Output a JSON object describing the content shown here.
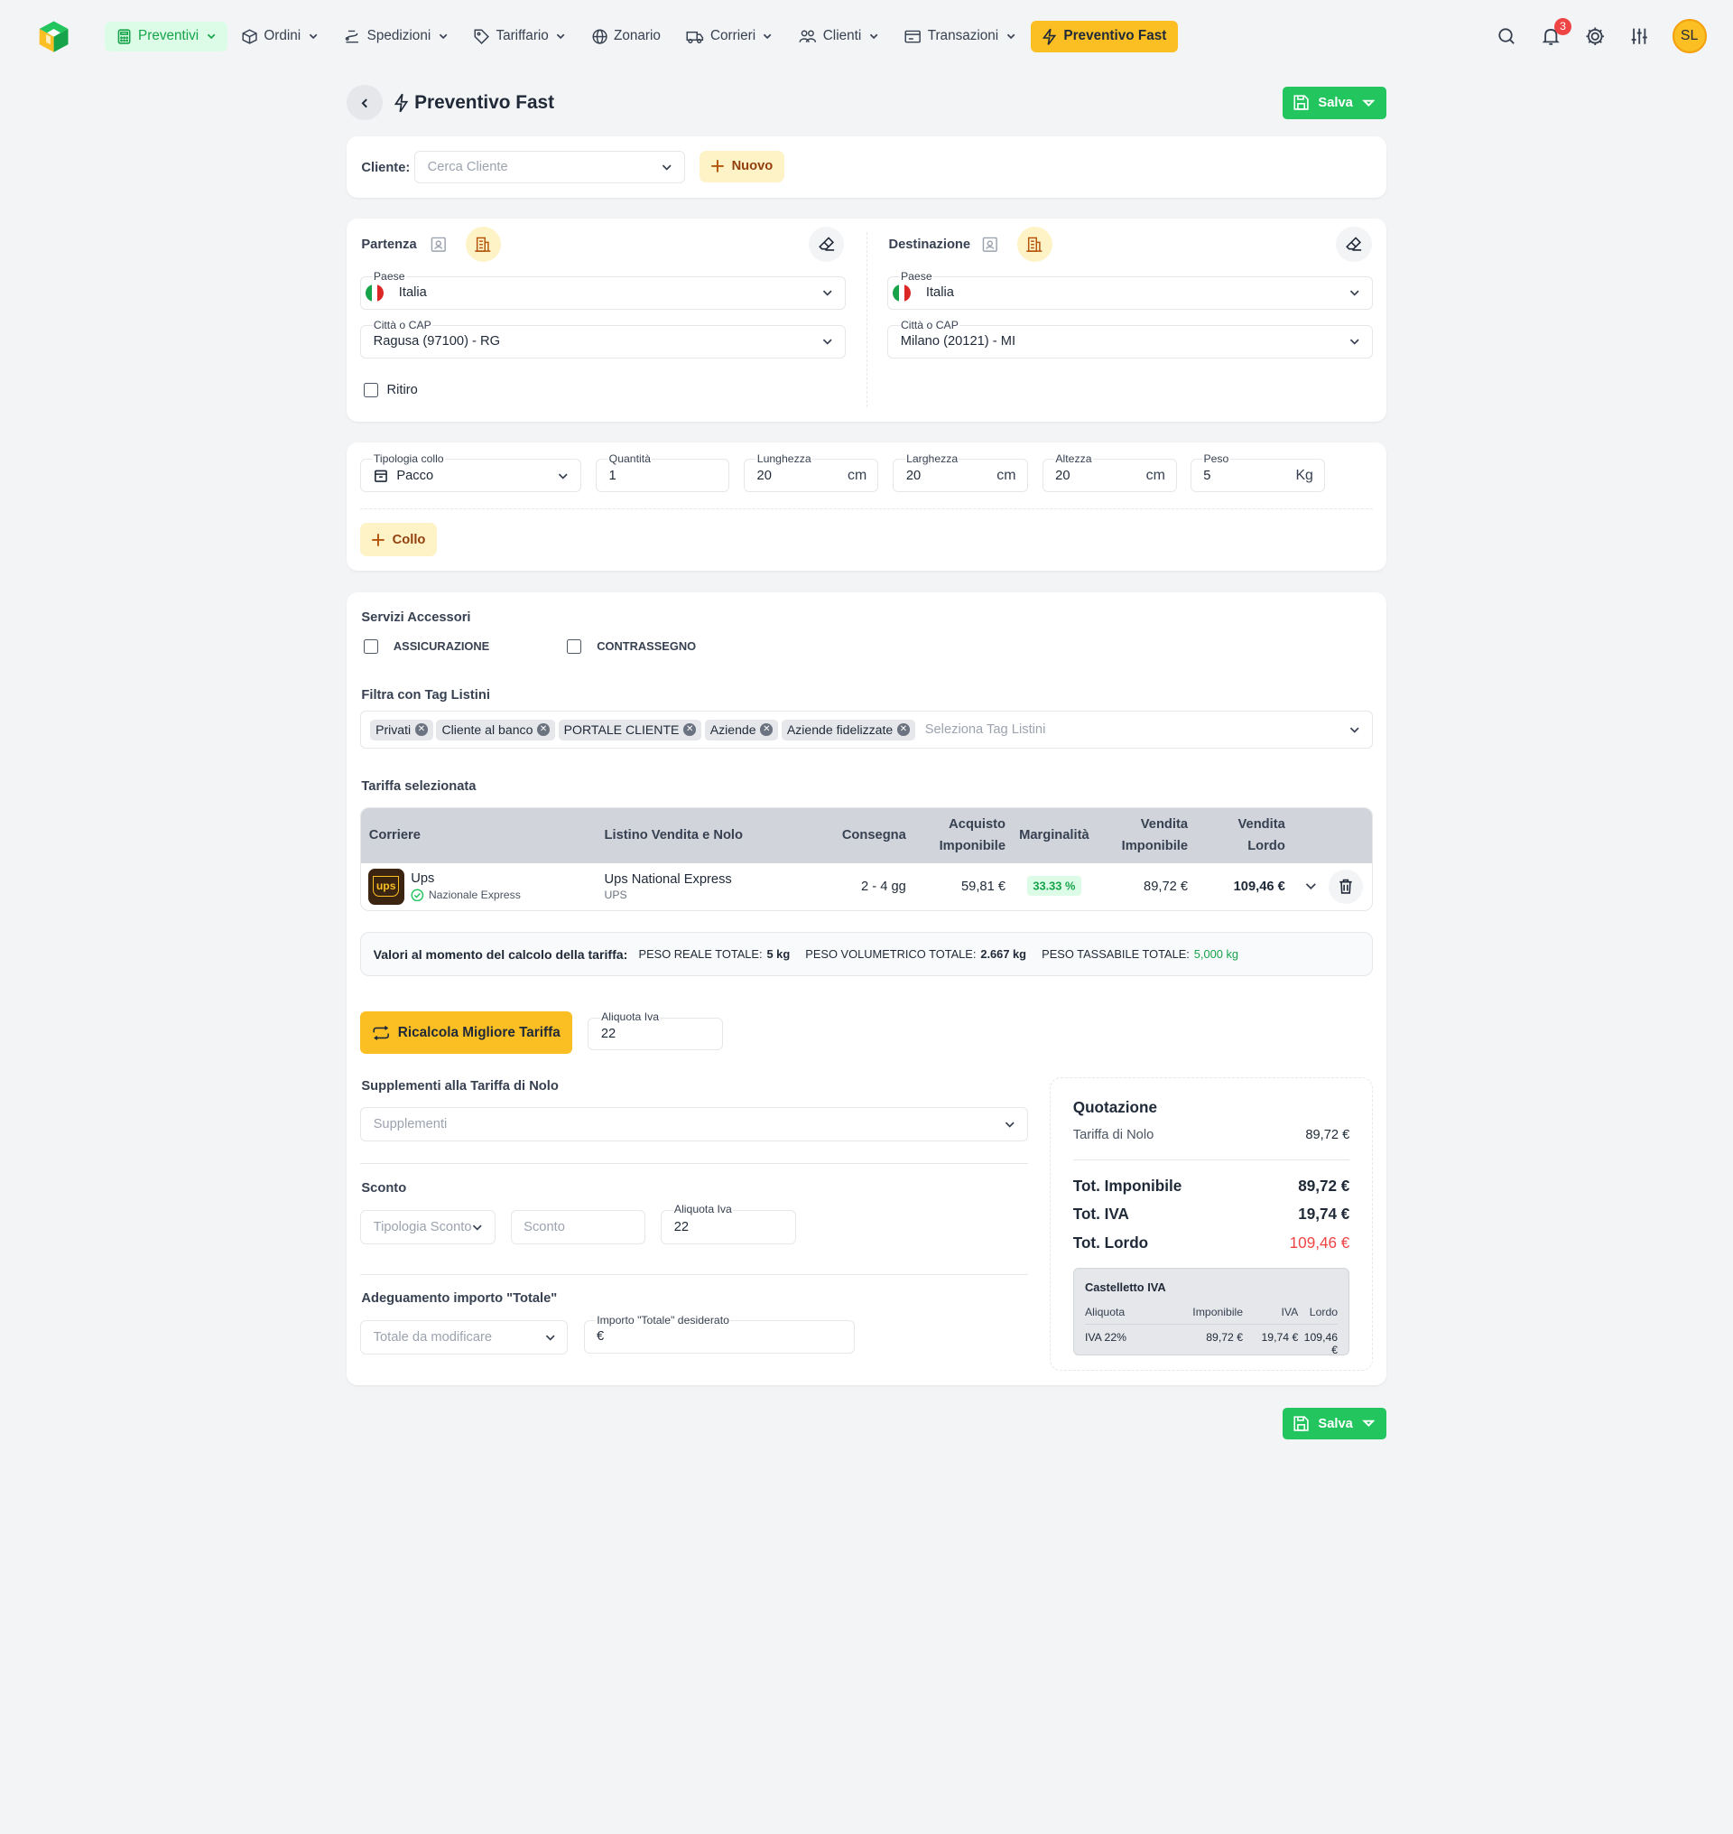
{
  "nav": {
    "items": [
      {
        "label": "Preventivi",
        "icon": "calculator-icon",
        "caret": true,
        "active": true
      },
      {
        "label": "Ordini",
        "icon": "box-icon",
        "caret": true
      },
      {
        "label": "Spedizioni",
        "icon": "truck-route-icon",
        "caret": true
      },
      {
        "label": "Tariffario",
        "icon": "tag-icon",
        "caret": true
      },
      {
        "label": "Zonario",
        "icon": "globe-icon",
        "caret": false
      },
      {
        "label": "Corrieri",
        "icon": "truck-icon",
        "caret": true
      },
      {
        "label": "Clienti",
        "icon": "users-icon",
        "caret": true
      },
      {
        "label": "Transazioni",
        "icon": "receipt-icon",
        "caret": true
      }
    ],
    "fast_label": "Preventivo Fast",
    "notifications_count": "3",
    "avatar_initials": "SL"
  },
  "page": {
    "title": "Preventivo Fast",
    "save_label": "Salva"
  },
  "cliente": {
    "label": "Cliente:",
    "placeholder": "Cerca Cliente",
    "new_label": "Nuovo"
  },
  "partenza": {
    "title": "Partenza",
    "paese_label": "Paese",
    "paese_value": "Italia",
    "citta_label": "Città o CAP",
    "citta_value": "Ragusa (97100) - RG",
    "ritiro_label": "Ritiro"
  },
  "destinazione": {
    "title": "Destinazione",
    "paese_label": "Paese",
    "paese_value": "Italia",
    "citta_label": "Città o CAP",
    "citta_value": "Milano (20121) - MI"
  },
  "collo": {
    "tipologia_label": "Tipologia collo",
    "tipologia_value": "Pacco",
    "quantita_label": "Quantità",
    "quantita_value": "1",
    "lunghezza_label": "Lunghezza",
    "lunghezza_value": "20",
    "larghezza_label": "Larghezza",
    "larghezza_value": "20",
    "altezza_label": "Altezza",
    "altezza_value": "20",
    "peso_label": "Peso",
    "peso_value": "5",
    "unit_cm": "cm",
    "unit_kg": "Kg",
    "add_label": "Collo"
  },
  "servizi": {
    "title": "Servizi Accessori",
    "assicurazione": "ASSICURAZIONE",
    "contrassegno": "CONTRASSEGNO"
  },
  "filtro": {
    "title": "Filtra con Tag Listini",
    "tags": [
      "Privati",
      "Cliente al banco",
      "PORTALE CLIENTE",
      "Aziende",
      "Aziende fidelizzate"
    ],
    "placeholder": "Seleziona Tag Listini"
  },
  "tariffa": {
    "title": "Tariffa selezionata",
    "headers": {
      "corriere": "Corriere",
      "listino": "Listino Vendita e Nolo",
      "consegna": "Consegna",
      "acquisto_1": "Acquisto",
      "acquisto_2": "Imponibile",
      "marginalita": "Marginalità",
      "vendita_imp_1": "Vendita",
      "vendita_imp_2": "Imponibile",
      "vendita_lordo_1": "Vendita",
      "vendita_lordo_2": "Lordo"
    },
    "row": {
      "carrier": "Ups",
      "logo_text": "ups",
      "service": "Nazionale Express",
      "listino": "Ups National Express",
      "listino_sub": "UPS",
      "consegna": "2 - 4 gg",
      "acquisto": "59,81 €",
      "marginalita": "33.33 %",
      "vendita_imp": "89,72 €",
      "vendita_lordo": "109,46 €"
    }
  },
  "valori": {
    "label": "Valori al momento del calcolo della tariffa:",
    "peso_reale_label": "PESO REALE TOTALE:",
    "peso_reale": "5 kg",
    "peso_vol_label": "PESO VOLUMETRICO TOTALE:",
    "peso_vol": "2.667 kg",
    "peso_tass_label": "PESO TASSABILE TOTALE:",
    "peso_tass": "5,000 kg"
  },
  "ricalcola_label": "Ricalcola Migliore Tariffa",
  "aliquota": {
    "label": "Aliquota Iva",
    "value": "22"
  },
  "supplementi": {
    "title": "Supplementi alla Tariffa di Nolo",
    "placeholder": "Supplementi"
  },
  "sconto": {
    "title": "Sconto",
    "tipologia_placeholder": "Tipologia Sconto",
    "sconto_placeholder": "Sconto",
    "aliquota_label": "Aliquota Iva",
    "aliquota_value": "22"
  },
  "adeguamento": {
    "title": "Adeguamento importo \"Totale\"",
    "totale_placeholder": "Totale da modificare",
    "importo_label": "Importo \"Totale\" desiderato",
    "importo_prefix": "€"
  },
  "quotazione": {
    "title": "Quotazione",
    "nolo_label": "Tariffa di Nolo",
    "nolo_value": "89,72 €",
    "imponibile_label": "Tot. Imponibile",
    "imponibile_value": "89,72 €",
    "iva_label": "Tot. IVA",
    "iva_value": "19,74 €",
    "lordo_label": "Tot. Lordo",
    "lordo_value": "109,46 €",
    "castelletto": {
      "title": "Castelletto IVA",
      "headers": [
        "Aliquota",
        "Imponibile",
        "IVA",
        "Lordo"
      ],
      "row": [
        "IVA 22%",
        "89,72 €",
        "19,74 €",
        "109,46 €"
      ]
    }
  },
  "colors": {
    "green": "#22c55e",
    "amber": "#fbbf24",
    "red": "#ef4444"
  }
}
